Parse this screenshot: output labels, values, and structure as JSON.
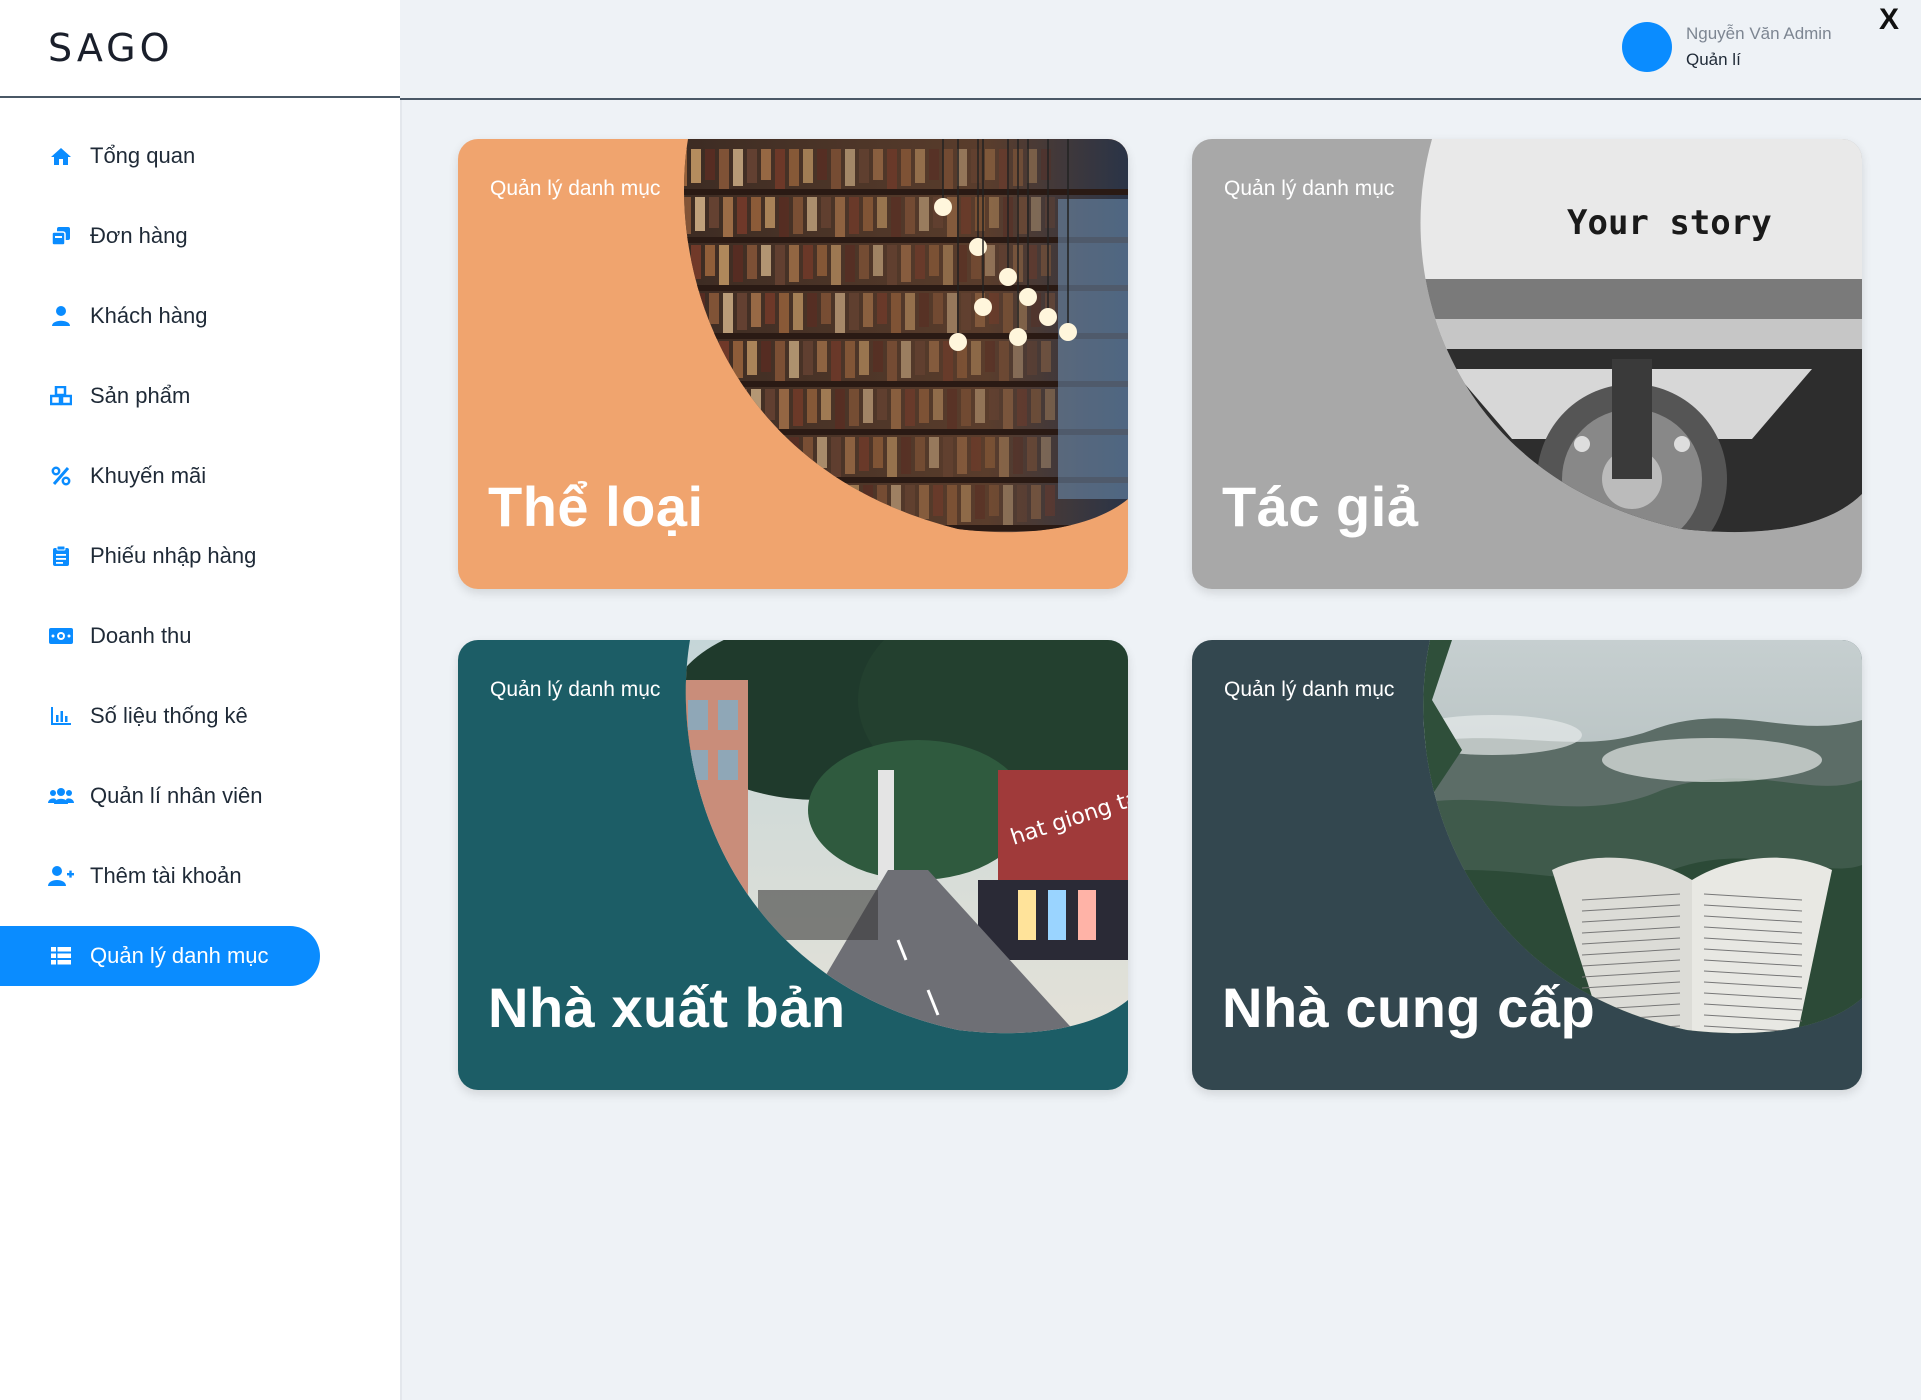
{
  "app": {
    "logo": "SAGO"
  },
  "user": {
    "name": "Nguyễn Văn Admin",
    "role": "Quản lí"
  },
  "close_label": "X",
  "sidebar": {
    "items": [
      {
        "label": "Tổng quan",
        "icon": "home-icon"
      },
      {
        "label": "Đơn hàng",
        "icon": "orders-icon"
      },
      {
        "label": "Khách hàng",
        "icon": "customer-icon"
      },
      {
        "label": "Sản phẩm",
        "icon": "products-icon"
      },
      {
        "label": "Khuyến mãi",
        "icon": "percent-icon"
      },
      {
        "label": "Phiếu nhập hàng",
        "icon": "clipboard-icon"
      },
      {
        "label": "Doanh thu",
        "icon": "money-icon"
      },
      {
        "label": "Số liệu thống kê",
        "icon": "chart-icon"
      },
      {
        "label": "Quản lí nhân viên",
        "icon": "staff-icon"
      },
      {
        "label": "Thêm tài khoản",
        "icon": "add-user-icon"
      },
      {
        "label": "Quản lý danh mục",
        "icon": "list-icon",
        "active": true
      }
    ]
  },
  "cards": [
    {
      "kicker": "Quản lý danh mục",
      "title": "Thể loại",
      "color": "#f0a46e",
      "image": "library-bookshelves"
    },
    {
      "kicker": "Quản lý danh mục",
      "title": "Tác giả",
      "color": "#a8a8a8",
      "image": "typewriter-your-story",
      "image_text": "Your story"
    },
    {
      "kicker": "Quản lý danh mục",
      "title": "Nhà xuất bản",
      "color": "#1c5d66",
      "image": "book-street",
      "image_text": "hat giong tam hồn"
    },
    {
      "kicker": "Quản lý danh mục",
      "title": "Nhà cung cấp",
      "color": "#33474f",
      "image": "open-book-forest"
    }
  ],
  "colors": {
    "accent": "#0a8cff",
    "background": "#eef2f6"
  }
}
